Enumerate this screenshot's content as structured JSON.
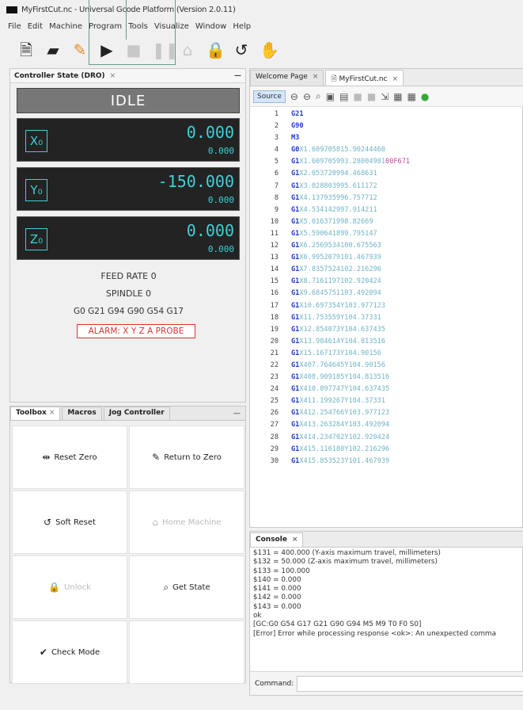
{
  "window": {
    "title": "MyFirstCut.nc - Universal Gcode Platform (Version 2.0.11)"
  },
  "menu": [
    "File",
    "Edit",
    "Machine",
    "Program",
    "Tools",
    "Visualize",
    "Window",
    "Help"
  ],
  "toolbar": {
    "icons": [
      "new-file-icon",
      "open-folder-icon",
      "eraser-icon",
      "play-icon",
      "stop-icon",
      "pause-icon",
      "home-icon",
      "lock-icon",
      "reset-icon",
      "hand-icon"
    ]
  },
  "dro": {
    "title": "Controller State (DRO)",
    "close": "×",
    "state": "IDLE",
    "axes": [
      {
        "label": "X₀",
        "value": "0.000",
        "sub": "0.000"
      },
      {
        "label": "Y₀",
        "value": "-150.000",
        "sub": "0.000"
      },
      {
        "label": "Z₀",
        "value": "0.000",
        "sub": "0.000"
      }
    ],
    "feed_rate": "FEED RATE 0",
    "spindle": "SPINDLE 0",
    "modal": "G0 G21 G94 G90 G54 G17",
    "alarm": "ALARM: X Y Z A PROBE",
    "accent": "#3fd0d6"
  },
  "toolbox": {
    "tabs": [
      "Toolbox",
      "Macros",
      "Jog Controller"
    ],
    "buttons": [
      {
        "label": "Reset Zero",
        "icon": "reset-zero-icon",
        "glyph": "⇹"
      },
      {
        "label": "Return to Zero",
        "icon": "return-zero-icon",
        "glyph": "✎"
      },
      {
        "label": "Soft Reset",
        "icon": "soft-reset-icon",
        "glyph": "↺"
      },
      {
        "label": "Home Machine",
        "icon": "home-icon",
        "glyph": "⌂"
      },
      {
        "label": "Unlock",
        "icon": "unlock-icon",
        "glyph": "🔒"
      },
      {
        "label": "Get State",
        "icon": "search-icon",
        "glyph": "⌕"
      },
      {
        "label": "Check Mode",
        "icon": "check-icon",
        "glyph": "✔"
      }
    ]
  },
  "editor": {
    "tabs": [
      "Welcome Page",
      "MyFirstCut.nc"
    ],
    "source_label": "Source",
    "lines": [
      {
        "n": "1",
        "cmd": "G21",
        "args": ""
      },
      {
        "n": "2",
        "cmd": "G90",
        "args": ""
      },
      {
        "n": "3",
        "cmd": "M3",
        "args": ""
      },
      {
        "n": "4",
        "cmd": "G0",
        "args": "X1.609705815.90244460",
        "extra": ""
      },
      {
        "n": "5",
        "cmd": "G1",
        "args": "X1.609705993.28004981",
        "extra": "00F671"
      },
      {
        "n": "6",
        "cmd": "G1",
        "args": "X2.053720994.468631",
        "extra": ""
      },
      {
        "n": "7",
        "cmd": "G1",
        "args": "X3.028803995.611172",
        "extra": ""
      },
      {
        "n": "8",
        "cmd": "G1",
        "args": "X4.137935996.757712",
        "extra": ""
      },
      {
        "n": "9",
        "cmd": "G1",
        "args": "X4.534142997.914211",
        "extra": ""
      },
      {
        "n": "10",
        "cmd": "G1",
        "args": "X5.016371998.82669",
        "extra": ""
      },
      {
        "n": "11",
        "cmd": "G1",
        "args": "X5.590641899.795147",
        "extra": ""
      },
      {
        "n": "12",
        "cmd": "G1",
        "args": "X6.2569534100.675563",
        "extra": ""
      },
      {
        "n": "13",
        "cmd": "G1",
        "args": "X6.9952079101.467939",
        "extra": ""
      },
      {
        "n": "14",
        "cmd": "G1",
        "args": "X7.8357524102.216296",
        "extra": ""
      },
      {
        "n": "15",
        "cmd": "G1",
        "args": "X8.7161197102.920424",
        "extra": ""
      },
      {
        "n": "16",
        "cmd": "G1",
        "args": "X9.6845751103.492094",
        "extra": ""
      },
      {
        "n": "17",
        "cmd": "G1",
        "args": "X10.697354Y103.977123",
        "extra": ""
      },
      {
        "n": "18",
        "cmd": "G1",
        "args": "X11.753559Y104.37331",
        "extra": ""
      },
      {
        "n": "19",
        "cmd": "G1",
        "args": "X12.854073Y104.637435",
        "extra": ""
      },
      {
        "n": "20",
        "cmd": "G1",
        "args": "X13.984614Y104.813516",
        "extra": ""
      },
      {
        "n": "21",
        "cmd": "G1",
        "args": "X15.167173Y104.90156",
        "extra": ""
      },
      {
        "n": "22",
        "cmd": "G1",
        "args": "X407.764645Y104.90156",
        "extra": ""
      },
      {
        "n": "23",
        "cmd": "G1",
        "args": "X408.909185Y104.813516",
        "extra": ""
      },
      {
        "n": "24",
        "cmd": "G1",
        "args": "X410.097747Y104.637435",
        "extra": ""
      },
      {
        "n": "25",
        "cmd": "G1",
        "args": "X411.199267Y104.37331",
        "extra": ""
      },
      {
        "n": "26",
        "cmd": "G1",
        "args": "X412.254766Y103.977123",
        "extra": ""
      },
      {
        "n": "27",
        "cmd": "G1",
        "args": "X413.263284Y103.492094",
        "extra": ""
      },
      {
        "n": "28",
        "cmd": "G1",
        "args": "X414.234702Y102.920424",
        "extra": ""
      },
      {
        "n": "29",
        "cmd": "G1",
        "args": "X415.116180Y102.216296",
        "extra": ""
      },
      {
        "n": "30",
        "cmd": "G1",
        "args": "X415.853523Y101.467939",
        "extra": ""
      }
    ]
  },
  "console": {
    "title": "Console",
    "lines": [
      "$131 = 400.000    (Y-axis maximum travel, millimeters)",
      "$132 = 50.000    (Z-axis maximum travel, millimeters)",
      "$133 = 100.000",
      "$140 = 0.000",
      "$141 = 0.000",
      "$142 = 0.000",
      "$143 = 0.000",
      "ok",
      "[GC:G0 G54 G17 G21 G90 G94 M5 M9 T0 F0 S0]",
      "[Error] Error while processing response <ok>: An unexpected comma"
    ],
    "command_label": "Command:"
  }
}
